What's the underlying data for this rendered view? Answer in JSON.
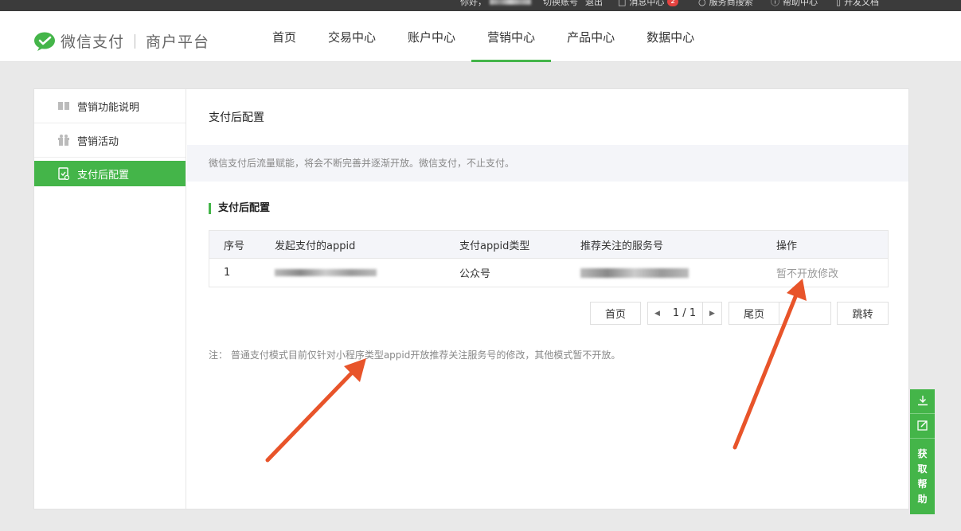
{
  "topbar": {
    "greeting": "你好，",
    "switch_account": "切换账号",
    "logout": "退出",
    "messages": "消息中心",
    "message_count": "2",
    "service_search": "服务商搜索",
    "help_center": "帮助中心",
    "dev_docs": "开发文档"
  },
  "header": {
    "brand": "微信支付",
    "subbrand": "商户平台",
    "nav": [
      "首页",
      "交易中心",
      "账户中心",
      "营销中心",
      "产品中心",
      "数据中心"
    ],
    "active_nav": "营销中心"
  },
  "sidebar": {
    "items": [
      {
        "label": "营销功能说明",
        "icon": "book-icon"
      },
      {
        "label": "营销活动",
        "icon": "gift-icon"
      },
      {
        "label": "支付后配置",
        "icon": "config-icon"
      }
    ],
    "active": "支付后配置"
  },
  "content": {
    "title": "支付后配置",
    "notice": "微信支付后流量赋能，将会不断完善并逐渐开放。微信支付，不止支付。",
    "section_title": "支付后配置",
    "table": {
      "headers": [
        "序号",
        "发起支付的appid",
        "支付appid类型",
        "推荐关注的服务号",
        "操作"
      ],
      "rows": [
        {
          "index": "1",
          "appid_type": "公众号",
          "action": "暂不开放修改"
        }
      ]
    },
    "pager": {
      "first": "首页",
      "page_info": "1 / 1",
      "last": "尾页",
      "jump": "跳转"
    },
    "footnote": "注：  普通支付模式目前仅针对小程序类型appid开放推荐关注服务号的修改，其他模式暂不开放。"
  },
  "float_help": {
    "label_chars": [
      "获",
      "取",
      "帮",
      "助"
    ]
  },
  "colors": {
    "brand_green": "#44b549",
    "annotation_arrow": "#e8542a",
    "topbar": "#3b3b3b"
  }
}
